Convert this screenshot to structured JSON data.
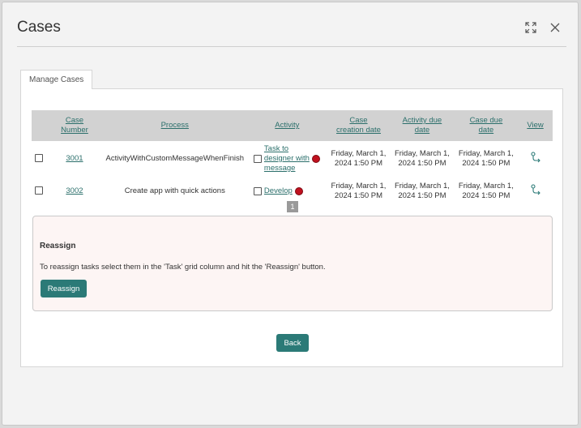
{
  "dialog": {
    "title": "Cases",
    "expand_icon": "expand-icon",
    "close_icon": "close-icon"
  },
  "tabs": [
    {
      "label": "Manage Cases",
      "active": true
    }
  ],
  "grid": {
    "columns": {
      "case_number": [
        "Case",
        "Number"
      ],
      "process": "Process",
      "activity": "Activity",
      "case_creation_date": [
        "Case",
        "creation date"
      ],
      "activity_due_date": [
        "Activity due",
        "date"
      ],
      "case_due_date": [
        "Case due",
        "date"
      ],
      "view": "View"
    },
    "rows": [
      {
        "case_number": "3001",
        "process": "ActivityWithCustomMessageWhenFinish",
        "activity": [
          "Task to",
          "designer with",
          "message"
        ],
        "status": "red",
        "case_creation_date": [
          "Friday, March 1,",
          "2024 1:50 PM"
        ],
        "activity_due_date": [
          "Friday, March 1,",
          "2024 1:50 PM"
        ],
        "case_due_date": [
          "Friday, March 1,",
          "2024 1:50 PM"
        ]
      },
      {
        "case_number": "3002",
        "process": "Create app with quick actions",
        "activity": [
          "Develop"
        ],
        "status": "red",
        "case_creation_date": [
          "Friday, March 1,",
          "2024 1:50 PM"
        ],
        "activity_due_date": [
          "Friday, March 1,",
          "2024 1:50 PM"
        ],
        "case_due_date": [
          "Friday, March 1,",
          "2024 1:50 PM"
        ]
      }
    ],
    "pager": {
      "current_page": "1"
    }
  },
  "reassign": {
    "title": "Reassign",
    "instructions": "To reassign tasks select them in the 'Task' grid column and hit the 'Reassign' button.",
    "button_label": "Reassign"
  },
  "footer": {
    "back_label": "Back"
  },
  "colors": {
    "accent": "#2b7a77",
    "link": "#2b6f6b",
    "status_red": "#c0111f",
    "reassign_bg": "#fdf5f4"
  }
}
